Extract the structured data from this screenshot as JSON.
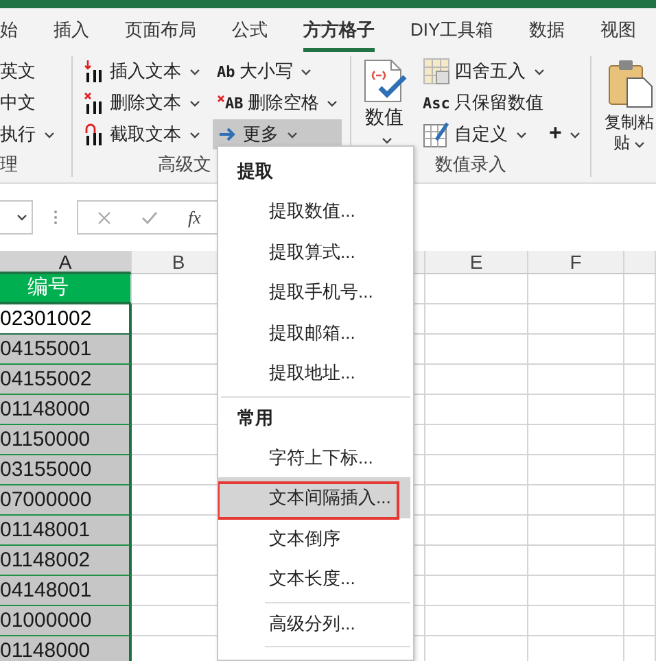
{
  "tabs": [
    {
      "label": "始",
      "selected": false
    },
    {
      "label": "插入",
      "selected": false
    },
    {
      "label": "页面布局",
      "selected": false
    },
    {
      "label": "公式",
      "selected": false
    },
    {
      "label": "方方格子",
      "selected": true
    },
    {
      "label": "DIY工具箱",
      "selected": false
    },
    {
      "label": "数据",
      "selected": false
    },
    {
      "label": "视图",
      "selected": false
    }
  ],
  "ribbon": {
    "groups": [
      {
        "label": "理",
        "columns": [
          [
            {
              "label": "英文",
              "dropdown": false
            },
            {
              "label": "中文",
              "dropdown": false
            },
            {
              "label": "执行",
              "dropdown": true
            }
          ]
        ]
      },
      {
        "label": "高级文",
        "columns": [
          [
            {
              "label": "插入文本",
              "dropdown": true
            },
            {
              "label": "删除文本",
              "dropdown": true
            },
            {
              "label": "截取文本",
              "dropdown": true
            }
          ],
          [
            {
              "label": "大小写",
              "dropdown": true,
              "icon_text": "Ab"
            },
            {
              "label": "删除空格",
              "dropdown": true,
              "icon_text": "AB"
            },
            {
              "label": "更多",
              "dropdown": true,
              "pressed": true
            }
          ]
        ]
      },
      {
        "label": "数值录入",
        "large": {
          "label": "数值",
          "dropdown": true
        },
        "columns": [
          [
            {
              "label": "四舍五入",
              "dropdown": true
            },
            {
              "label": "只保留数值",
              "dropdown": false,
              "icon_text": "Asc"
            },
            {
              "label": "自定义",
              "dropdown": true,
              "extra": {
                "label": "+",
                "dropdown": true
              }
            }
          ]
        ]
      },
      {
        "large": {
          "label": "复制粘贴",
          "dropdown": true
        }
      }
    ]
  },
  "formula_bar": {
    "function_button": "fx"
  },
  "sheet": {
    "columns": [
      {
        "label": "A",
        "selected": true
      },
      {
        "label": "B",
        "selected": false
      },
      {
        "label": "E",
        "selected": false
      },
      {
        "label": "F",
        "selected": false
      }
    ],
    "rows": [
      {
        "value": "编号",
        "kind": "header"
      },
      {
        "value": "02301002",
        "kind": "data",
        "selected": false
      },
      {
        "value": "04155001",
        "kind": "data",
        "selected": true
      },
      {
        "value": "04155002",
        "kind": "data",
        "selected": true
      },
      {
        "value": "01148000",
        "kind": "data",
        "selected": true
      },
      {
        "value": "01150000",
        "kind": "data",
        "selected": true
      },
      {
        "value": "03155000",
        "kind": "data",
        "selected": true
      },
      {
        "value": "07000000",
        "kind": "data",
        "selected": true
      },
      {
        "value": "01148001",
        "kind": "data",
        "selected": true
      },
      {
        "value": "01148002",
        "kind": "data",
        "selected": true
      },
      {
        "value": "04148001",
        "kind": "data",
        "selected": true
      },
      {
        "value": "01000000",
        "kind": "data",
        "selected": true
      },
      {
        "value": "01148000",
        "kind": "data",
        "selected": true
      }
    ]
  },
  "menu": {
    "sections": [
      {
        "title": "提取",
        "items": [
          {
            "kind": "item",
            "label": "提取数值...",
            "highlighted": false,
            "outlined": false
          },
          {
            "kind": "item",
            "label": "提取算式...",
            "highlighted": false,
            "outlined": false
          },
          {
            "kind": "item",
            "label": "提取手机号...",
            "highlighted": false,
            "outlined": false
          },
          {
            "kind": "item",
            "label": "提取邮箱...",
            "highlighted": false,
            "outlined": false
          },
          {
            "kind": "item",
            "label": "提取地址...",
            "highlighted": false,
            "outlined": false
          }
        ]
      },
      {
        "title": "常用",
        "items": [
          {
            "kind": "item",
            "label": "字符上下标...",
            "highlighted": false,
            "outlined": false
          },
          {
            "kind": "item",
            "label": "文本间隔插入...",
            "highlighted": true,
            "outlined": true
          },
          {
            "kind": "item",
            "label": "文本倒序",
            "highlighted": false,
            "outlined": false
          },
          {
            "kind": "item",
            "label": "文本长度...",
            "highlighted": false,
            "outlined": false
          },
          {
            "kind": "separator"
          },
          {
            "kind": "item",
            "label": "高级分列...",
            "highlighted": false,
            "outlined": false
          },
          {
            "kind": "separator"
          }
        ]
      }
    ]
  }
}
